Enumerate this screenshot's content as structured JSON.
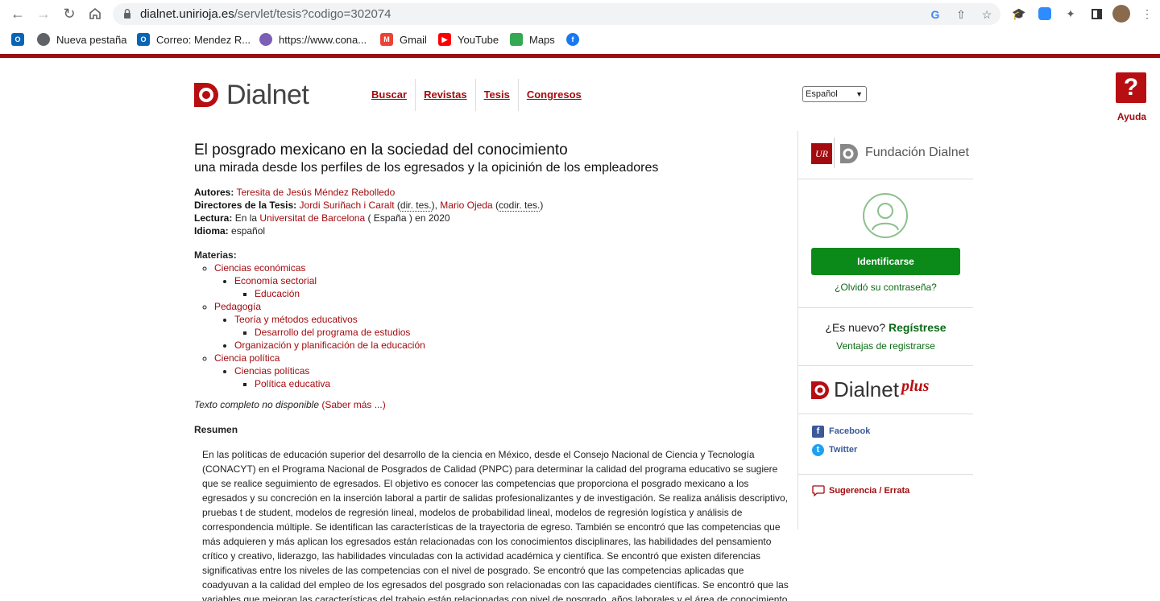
{
  "browser": {
    "url_host": "dialnet.unirioja.es",
    "url_path": "/servlet/tesis?codigo=302074",
    "bookmarks": [
      {
        "label": "",
        "icon": "outlook-icon"
      },
      {
        "label": "Nueva pestaña",
        "icon": "globe-icon"
      },
      {
        "label": "Correo: Mendez R...",
        "icon": "outlook-icon"
      },
      {
        "label": "https://www.cona...",
        "icon": "conacyt-icon"
      },
      {
        "label": "Gmail",
        "icon": "gmail-icon"
      },
      {
        "label": "YouTube",
        "icon": "youtube-icon"
      },
      {
        "label": "Maps",
        "icon": "maps-icon"
      },
      {
        "label": "",
        "icon": "facebook-icon"
      }
    ]
  },
  "header": {
    "logo_text": "Dialnet",
    "nav": [
      "Buscar",
      "Revistas",
      "Tesis",
      "Congresos"
    ],
    "language": "Español",
    "help_label": "Ayuda"
  },
  "thesis": {
    "title": "El posgrado mexicano en la sociedad del conocimiento",
    "subtitle": "una mirada desde los perfiles de los egresados y la opicinión de los empleadores",
    "authors_label": "Autores:",
    "author": "Teresita de Jesús Méndez Rebolledo",
    "directors_label": "Directores de la Tesis:",
    "director1": "Jordi Suriñach i Caralt",
    "director1_role": "dir. tes.",
    "director2": "Mario Ojeda",
    "director2_role": "codir. tes.",
    "reading_label": "Lectura:",
    "reading_pre": "En la",
    "university": "Universitat de Barcelona",
    "reading_post": "( España ) en 2020",
    "language_label": "Idioma:",
    "language": "español",
    "subjects_label": "Materias:",
    "subjects": {
      "a": "Ciencias económicas",
      "a1": "Economía sectorial",
      "a1a": "Educación",
      "b": "Pedagogía",
      "b1": "Teoría y métodos educativos",
      "b1a": "Desarrollo del programa de estudios",
      "b2": "Organización y planificación de la educación",
      "c": "Ciencia política",
      "c1": "Ciencias políticas",
      "c1a": "Política educativa"
    },
    "fulltext": "Texto completo no disponible",
    "fulltext_link": "(Saber más ...)",
    "abstract_label": "Resumen",
    "abstract": "En las políticas de educación superior del desarrollo de la ciencia en México, desde el Consejo Nacional de Ciencia y Tecnología (CONACYT) en el Programa Nacional de Posgrados de Calidad (PNPC) para determinar la calidad del programa educativo se sugiere que se realice seguimiento de egresados. El objetivo es conocer las competencias que proporciona el posgrado mexicano a los egresados y su concreción en la inserción laboral a partir de salidas profesionalizantes y de investigación. Se realiza análisis descriptivo, pruebas t de student, modelos de regresión lineal, modelos de probabilidad lineal, modelos de regresión logística y análisis de correspondencia múltiple. Se identifican las características de la trayectoria de egreso. También se encontró que las competencias que más adquieren y más aplican los egresados están relacionadas con los conocimientos disciplinares, las habilidades del pensamiento crítico y creativo, liderazgo, las habilidades vinculadas con la actividad académica y científica. Se encontró que existen diferencias significativas entre los niveles de las competencias con el nivel de posgrado. Se encontró que las competencias aplicadas que coadyuvan a la calidad del empleo de los egresados del posgrado son relacionadas con las capacidades científicas. Se encontró que las variables que mejoran las características del trabajo están relacionadas con nivel de posgrado, años laborales y el área de conocimiento."
  },
  "sidebar": {
    "foundation": "Fundación Dialnet",
    "login_button": "Identificarse",
    "forgot": "¿Olvidó su contraseña?",
    "new_q": "¿Es nuevo?",
    "register": "Regístrese",
    "advantages": "Ventajas de registrarse",
    "plus_word": "Dialnet",
    "plus_suffix": "plus",
    "facebook": "Facebook",
    "twitter": "Twitter",
    "errata": "Sugerencia / Errata"
  },
  "colors": {
    "brand_red": "#a30b0f",
    "green": "#0b8a1a"
  }
}
